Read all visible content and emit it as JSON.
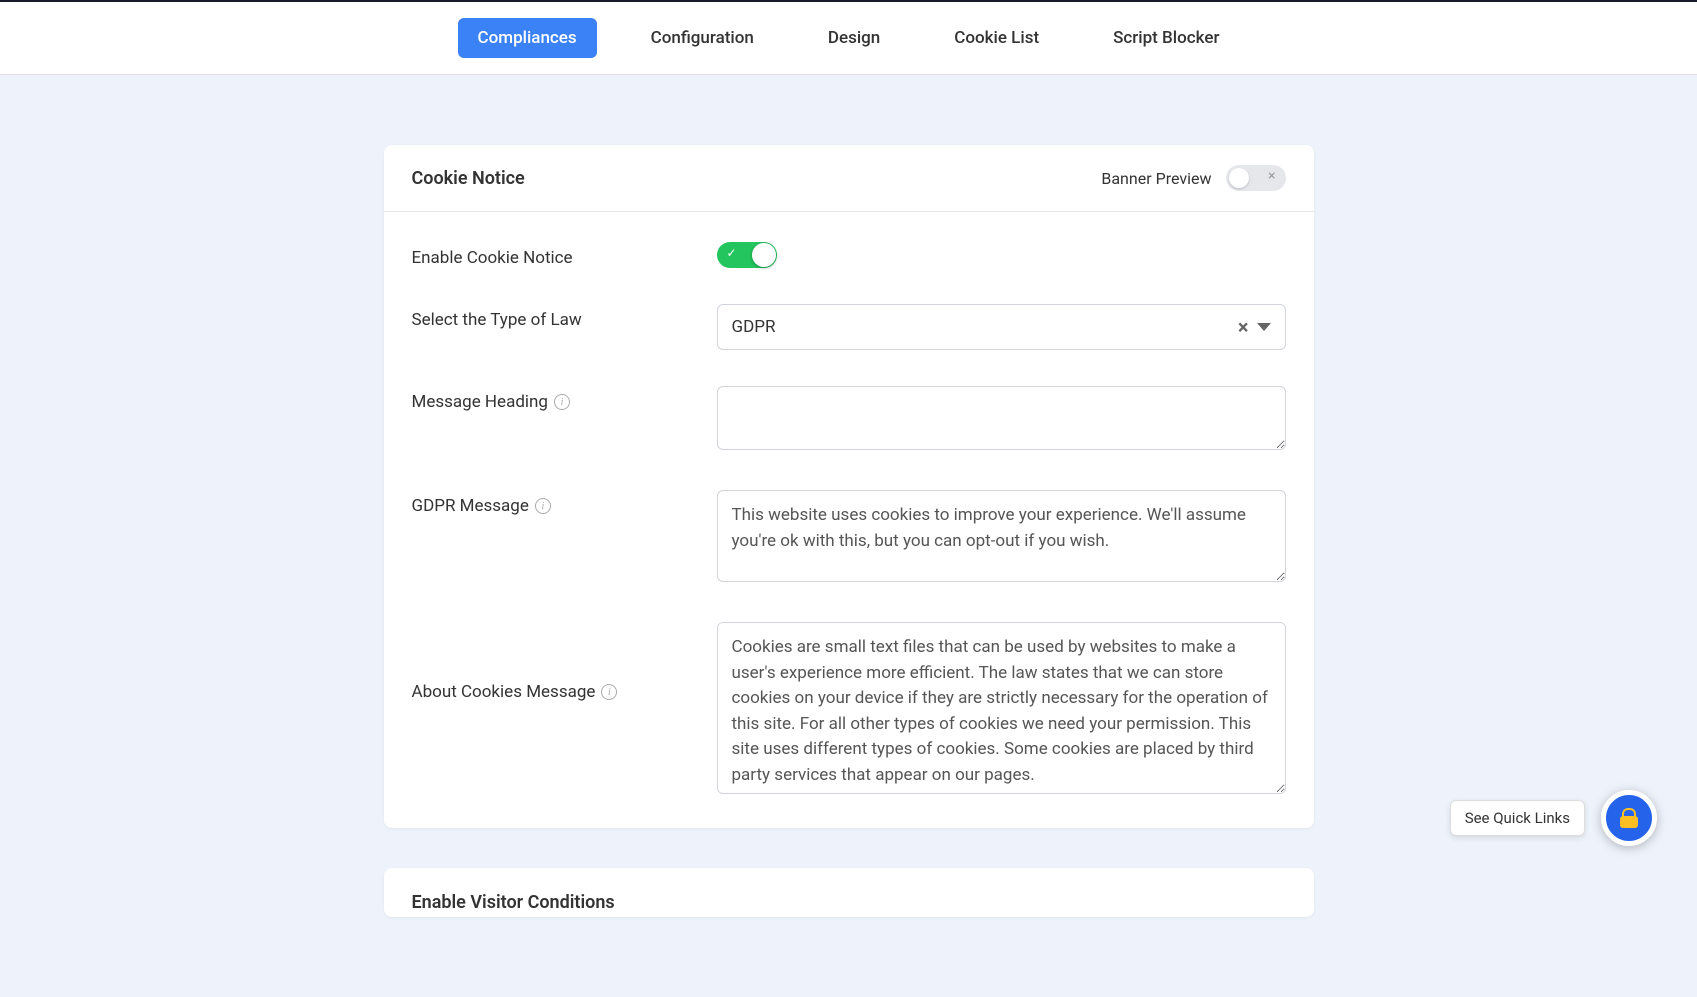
{
  "tabs": [
    {
      "label": "Compliances",
      "active": true
    },
    {
      "label": "Configuration",
      "active": false
    },
    {
      "label": "Design",
      "active": false
    },
    {
      "label": "Cookie List",
      "active": false
    },
    {
      "label": "Script Blocker",
      "active": false
    }
  ],
  "card": {
    "title": "Cookie Notice",
    "banner_preview_label": "Banner Preview"
  },
  "fields": {
    "enable_label": "Enable Cookie Notice",
    "law_label": "Select the Type of Law",
    "law_value": "GDPR",
    "heading_label": "Message Heading",
    "heading_value": "",
    "gdpr_label": "GDPR Message",
    "gdpr_value": "This website uses cookies to improve your experience. We'll assume you're ok with this, but you can opt-out if you wish.",
    "about_label": "About Cookies Message",
    "about_value": "Cookies are small text files that can be used by websites to make a user's experience more efficient. The law states that we can store cookies on your device if they are strictly necessary for the operation of this site. For all other types of cookies we need your permission. This site uses different types of cookies. Some cookies are placed by third party services that appear on our pages."
  },
  "visitor_section": {
    "title": "Enable Visitor Conditions"
  },
  "quick_links": {
    "label": "See Quick Links"
  }
}
